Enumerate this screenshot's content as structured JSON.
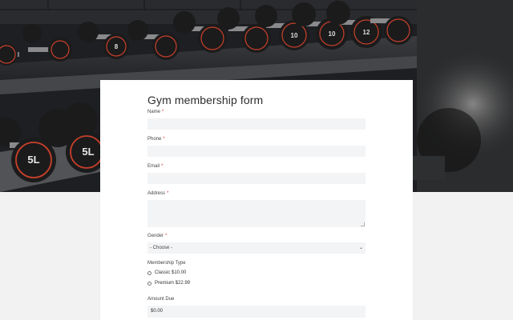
{
  "form": {
    "title": "Gym membership form",
    "fields": {
      "name": {
        "label": "Name",
        "required": "*",
        "value": ""
      },
      "phone": {
        "label": "Phone",
        "required": "*",
        "value": ""
      },
      "email": {
        "label": "Email",
        "required": "*",
        "value": ""
      },
      "address": {
        "label": "Address",
        "required": "*",
        "value": ""
      },
      "gender": {
        "label": "Gender",
        "required": "*",
        "selected": "- Choose -"
      },
      "membership": {
        "label": "Membership Type",
        "options": [
          {
            "label": "Classic $10.00",
            "checked": false
          },
          {
            "label": "Premium $22.99",
            "checked": false
          }
        ]
      },
      "amount_due": {
        "label": "Amount Due",
        "value": "$0.00"
      }
    }
  },
  "hero": {
    "dumbbell_numbers": [
      "8",
      "10",
      "10",
      "12",
      "12",
      "5L",
      "5L"
    ]
  },
  "colors": {
    "required_marker": "#d9343b",
    "field_background": "#f3f4f6",
    "page_background": "#f2f2f2",
    "dumbbell_accent": "#c8402a"
  }
}
